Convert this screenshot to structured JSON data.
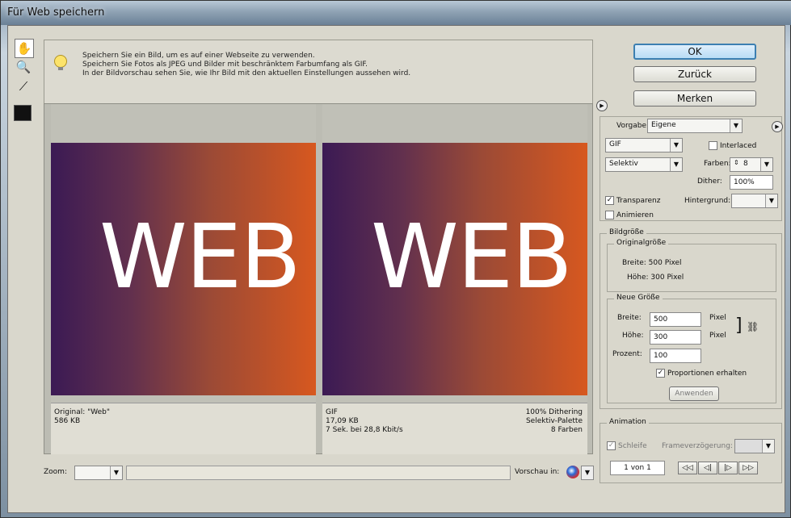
{
  "window": {
    "title": "Für Web speichern"
  },
  "info": {
    "line1": "Speichern Sie ein Bild, um es auf einer Webseite zu verwenden.",
    "line2": "Speichern Sie Fotos als JPEG und Bilder mit beschränktem Farbumfang als GIF.",
    "line3": "In der Bildvorschau sehen Sie, wie Ihr Bild mit den aktuellen Einstellungen aussehen wird."
  },
  "tools": {
    "hand": "hand-tool-icon",
    "zoom": "zoom-tool-icon",
    "eyedropper": "eyedropper-icon"
  },
  "preview": {
    "left": {
      "art_text": "WEB",
      "title": "Original: \"Web\"",
      "size": "586 KB"
    },
    "right": {
      "art_text": "WEB",
      "format": "GIF",
      "size": "17,09 KB",
      "time": "7 Sek. bei 28,8 Kbit/s",
      "dithering": "100% Dithering",
      "palette": "Selektiv-Palette",
      "colors": "8 Farben"
    }
  },
  "bottom": {
    "zoom_label": "Zoom:",
    "zoom_value": "",
    "preview_label": "Vorschau in:"
  },
  "buttons": {
    "ok": "OK",
    "back": "Zurück",
    "remember": "Merken",
    "apply": "Anwenden"
  },
  "settings": {
    "preset_label": "Vorgabe:",
    "preset_value": "Eigene",
    "format": "GIF",
    "palette": "Selektiv",
    "interlaced_label": "Interlaced",
    "colors_label": "Farben:",
    "colors_value": "8",
    "dither_label": "Dither:",
    "dither_value": "100%",
    "transparency_label": "Transparenz",
    "background_label": "Hintergrund:",
    "animate_label": "Animieren"
  },
  "imagesize": {
    "group_label": "Bildgröße",
    "original_label": "Originalgröße",
    "orig_width": "Breite: 500 Pixel",
    "orig_height": "Höhe: 300 Pixel",
    "new_label": "Neue Größe",
    "width_label": "Breite:",
    "width_value": "500",
    "height_label": "Höhe:",
    "height_value": "300",
    "unit": "Pixel",
    "percent_label": "Prozent:",
    "percent_value": "100",
    "keep_proportions": "Proportionen erhalten"
  },
  "animation": {
    "group_label": "Animation",
    "loop_label": "Schleife",
    "delay_label": "Frameverzögerung:",
    "frame_counter": "1 von 1",
    "nav": [
      "◁◁",
      "◁|",
      "|▷",
      "▷▷"
    ]
  }
}
